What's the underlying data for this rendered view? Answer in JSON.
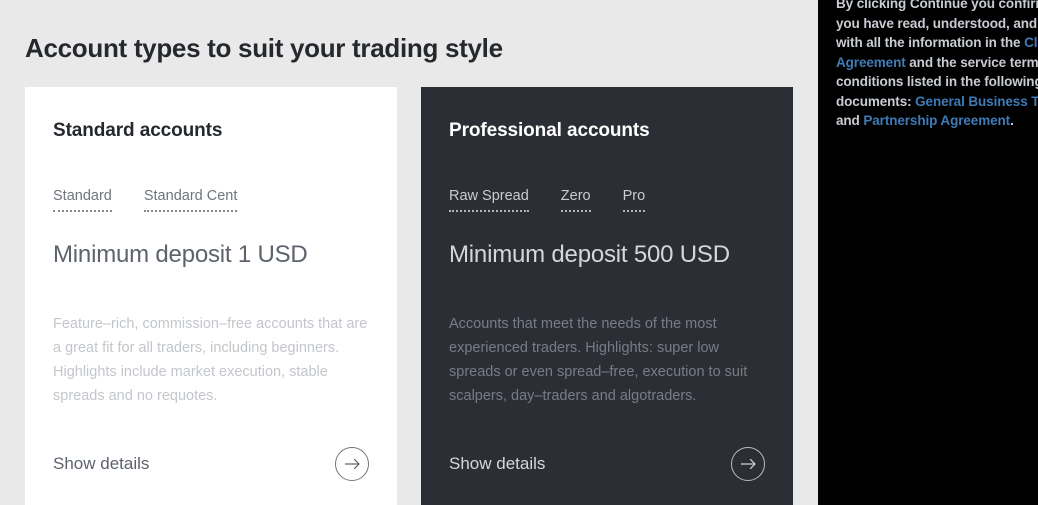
{
  "page": {
    "title": "Account types to suit your trading style",
    "background_color": "#e9e9e9"
  },
  "cards": [
    {
      "id": "standard",
      "title": "Standard accounts",
      "theme": "light",
      "background_color": "#ffffff",
      "tabs": [
        {
          "label": "Standard"
        },
        {
          "label": "Standard Cent"
        }
      ],
      "deposit": "Minimum deposit 1 USD",
      "description": "Feature–rich, commission–free accounts that are a great fit for all traders, including beginners. Highlights include market execution, stable spreads and no requotes.",
      "details_label": "Show details",
      "details_icon": "arrow-right-icon"
    },
    {
      "id": "professional",
      "title": "Professional accounts",
      "theme": "dark",
      "background_color": "#2b2e34",
      "tabs": [
        {
          "label": "Raw Spread"
        },
        {
          "label": "Zero"
        },
        {
          "label": "Pro"
        }
      ],
      "deposit": "Minimum deposit 500 USD",
      "description": "Accounts that meet the needs of the most experienced traders. Highlights: super low spreads or even spread–free, execution to suit scalpers, day–traders and algotraders.",
      "details_label": "Show details",
      "details_icon": "arrow-right-icon"
    }
  ],
  "side_panel": {
    "background_color": "#000000",
    "link_color": "#3f7bb6",
    "segments": [
      {
        "type": "text",
        "value": "By clicking Continue you confirm that you have read, understood, and agree with all the information in the "
      },
      {
        "type": "link",
        "value": "Client Agreement"
      },
      {
        "type": "text",
        "value": " and the service terms and conditions listed in the following documents: "
      },
      {
        "type": "link",
        "value": "General Business Terms"
      },
      {
        "type": "text",
        "value": " and "
      },
      {
        "type": "link",
        "value": "Partnership Agreement"
      },
      {
        "type": "text",
        "value": "."
      }
    ]
  }
}
